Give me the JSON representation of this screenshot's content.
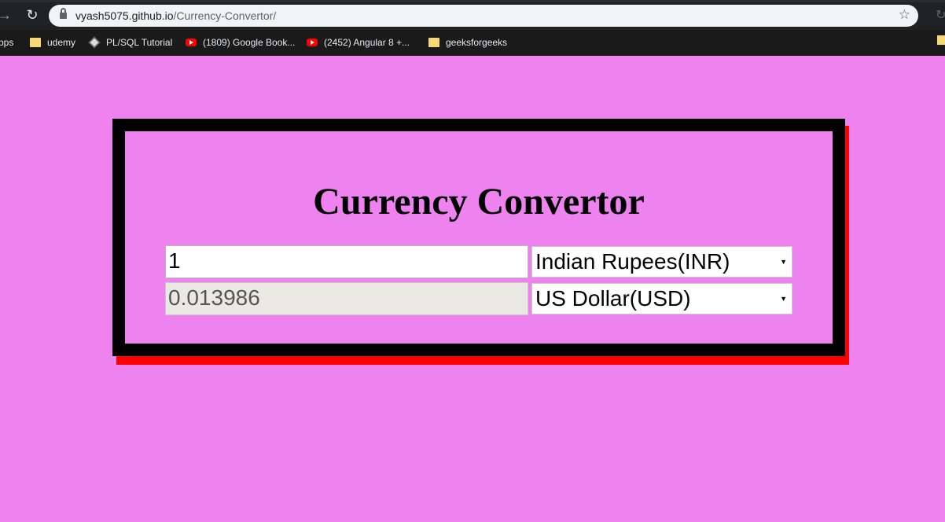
{
  "browser": {
    "url_host": "vyash5075.github.io",
    "url_path": "/Currency-Convertor/",
    "bookmarks": [
      {
        "label": "pps",
        "icon": "apps"
      },
      {
        "label": "udemy",
        "icon": "folder-icon"
      },
      {
        "label": "PL/SQL Tutorial",
        "icon": "plsql-icon"
      },
      {
        "label": "(1809) Google Book...",
        "icon": "youtube-icon"
      },
      {
        "label": "(2452) Angular 8 +...",
        "icon": "youtube-icon"
      },
      {
        "label": "geeksforgeeks",
        "icon": "folder-icon"
      }
    ]
  },
  "page": {
    "title": "Currency Convertor",
    "amount_value": "1",
    "result_value": "0.013986",
    "from_currency": "Indian Rupees(INR)",
    "to_currency": "US Dollar(USD)"
  },
  "colors": {
    "background": "#ee82ee",
    "card_border": "#000000",
    "card_shadow": "#ff0000"
  }
}
